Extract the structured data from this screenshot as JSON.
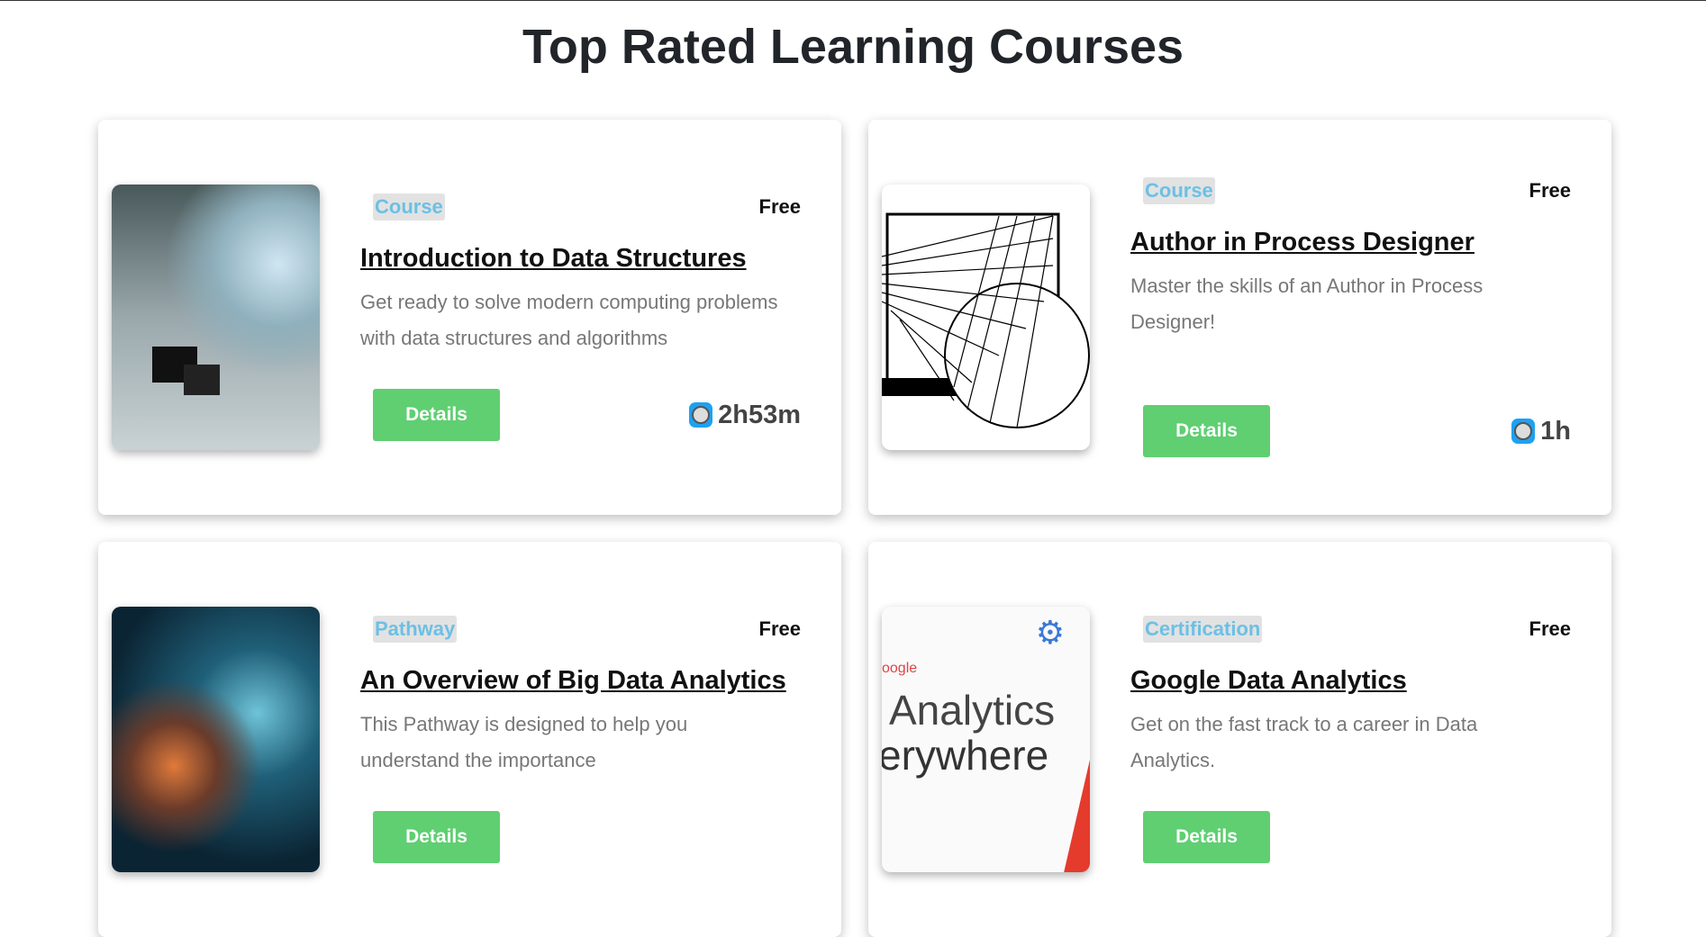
{
  "page_title": "Top Rated Learning Courses",
  "courses": [
    {
      "type": "Course",
      "price": "Free",
      "title": "Introduction to Data Structures",
      "description": "Get ready to solve modern computing problems with data structures and algorithms",
      "button": "Details",
      "duration": "2h53m"
    },
    {
      "type": "Course",
      "price": "Free",
      "title": "Author in Process Designer",
      "description": "Master the skills of an Author in Process Designer!",
      "button": "Details",
      "duration": "1h"
    },
    {
      "type": "Pathway",
      "price": "Free",
      "title": "An Overview of Big Data Analytics",
      "description": "This Pathway is designed to help you understand the importance",
      "button": "Details",
      "duration": ""
    },
    {
      "type": "Certification",
      "price": "Free",
      "title": "Google Data Analytics",
      "description": "Get on the fast track to a career in Data Analytics.",
      "button": "Details",
      "duration": ""
    }
  ],
  "thumb_text": {
    "brand": "oogle",
    "line1": "Analytics",
    "line2": "erywhere"
  }
}
